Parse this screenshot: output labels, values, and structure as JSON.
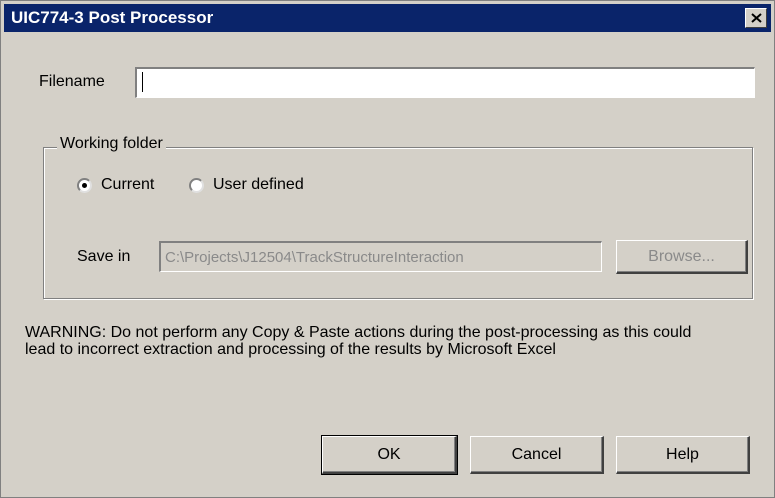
{
  "window": {
    "title": "UIC774-3 Post Processor"
  },
  "filename": {
    "label": "Filename",
    "value": ""
  },
  "working_folder": {
    "legend": "Working folder",
    "options": [
      {
        "label": "Current",
        "selected": true
      },
      {
        "label": "User defined",
        "selected": false
      }
    ],
    "save_in_label": "Save in",
    "save_in_value": "C:\\Projects\\J12504\\TrackStructureInteraction",
    "browse_label": "Browse..."
  },
  "warning": {
    "text": "WARNING: Do not perform any Copy & Paste actions during the post-processing as this could lead to incorrect extraction and processing of the results by Microsoft Excel"
  },
  "buttons": {
    "ok": "OK",
    "cancel": "Cancel",
    "help": "Help"
  }
}
